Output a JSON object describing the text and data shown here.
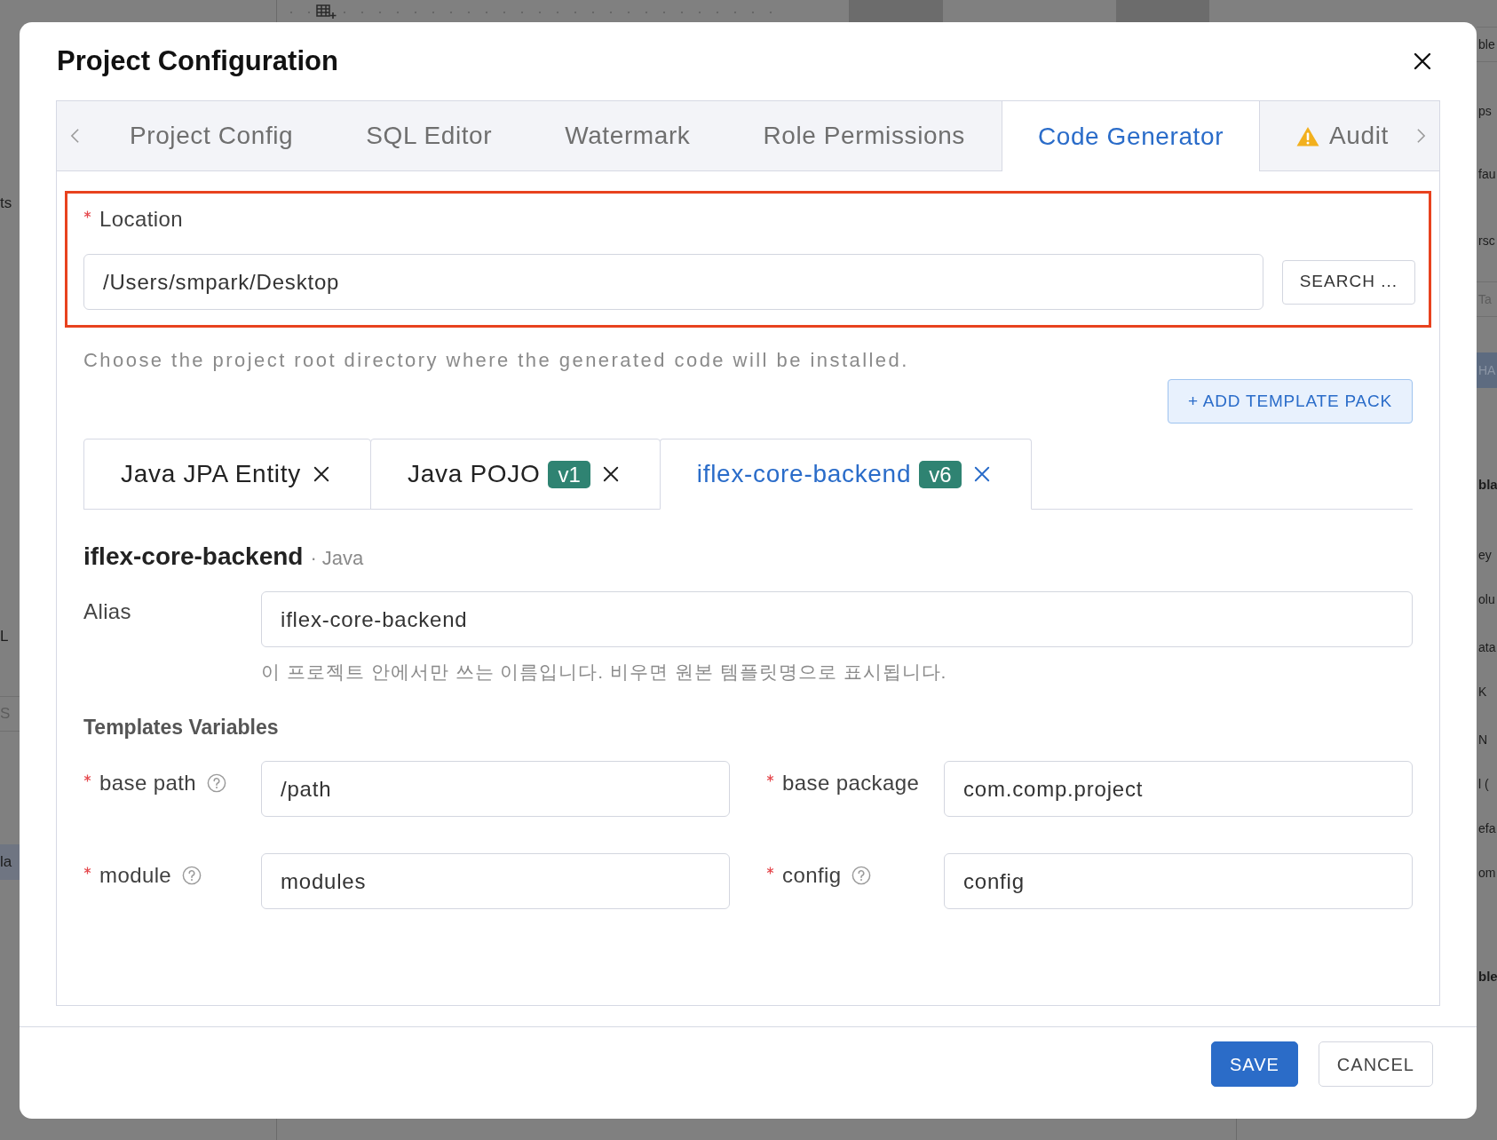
{
  "backdrop": {
    "left_fragments": [
      {
        "text": "ts",
        "kind": "row"
      },
      {
        "text": "L",
        "kind": "row"
      },
      {
        "text": "S",
        "kind": "placeholder"
      },
      {
        "text": "la",
        "kind": "selected"
      }
    ],
    "right_fragments": [
      {
        "text": "ble",
        "kind": "field"
      },
      {
        "text": "ps",
        "kind": "row"
      },
      {
        "text": "fau",
        "kind": "row"
      },
      {
        "text": "rsc",
        "kind": "row"
      },
      {
        "text": "Ta",
        "kind": "placeholder"
      },
      {
        "text": "HA",
        "kind": "button"
      },
      {
        "text": "bla",
        "kind": "heading"
      },
      {
        "text": "ey",
        "kind": "row"
      },
      {
        "text": "olu",
        "kind": "row"
      },
      {
        "text": "ata",
        "kind": "row"
      },
      {
        "text": "K",
        "kind": "row"
      },
      {
        "text": "N",
        "kind": "row"
      },
      {
        "text": "l (",
        "kind": "row"
      },
      {
        "text": "efa",
        "kind": "row"
      },
      {
        "text": "om",
        "kind": "row"
      },
      {
        "text": "ble",
        "kind": "heading"
      }
    ]
  },
  "dialog": {
    "title": "Project Configuration",
    "tabs": [
      {
        "label": "Project Config",
        "selected": false,
        "warning": false
      },
      {
        "label": "SQL Editor",
        "selected": false,
        "warning": false
      },
      {
        "label": "Watermark",
        "selected": false,
        "warning": false
      },
      {
        "label": "Role Permissions",
        "selected": false,
        "warning": false
      },
      {
        "label": "Code Generator",
        "selected": true,
        "warning": false
      },
      {
        "label": "Audit",
        "selected": false,
        "warning": true
      }
    ],
    "location": {
      "label": "Location",
      "required": true,
      "highlighted": true,
      "value": "/Users/smpark/Desktop",
      "button": "SEARCH ...",
      "help": "Choose the project root directory where the generated code will be installed."
    },
    "add_template_button": "+ ADD TEMPLATE PACK",
    "template_tabs": [
      {
        "label": "Java JPA Entity",
        "selected": false
      },
      {
        "label": "Java POJO",
        "badge": "v1",
        "selected": false
      },
      {
        "label": "iflex-core-backend",
        "badge": "v6",
        "selected": true
      }
    ],
    "template": {
      "name": "iflex-core-backend",
      "language": "· Java",
      "alias_label": "Alias",
      "alias_value": "iflex-core-backend",
      "alias_hint": "이 프로젝트 안에서만 쓰는 이름입니다. 비우면 원본 템플릿명으로 표시됩니다.",
      "variables_title": "Templates Variables",
      "variables": [
        {
          "label": "base path",
          "required": true,
          "help": true,
          "value": "/path"
        },
        {
          "label": "base package",
          "required": true,
          "help": false,
          "value": "com.comp.project"
        },
        {
          "label": "module",
          "required": true,
          "help": true,
          "value": "modules"
        },
        {
          "label": "config",
          "required": true,
          "help": true,
          "value": "config"
        }
      ]
    },
    "buttons": [
      {
        "label": "SAVE",
        "kind": "primary"
      },
      {
        "label": "CANCEL",
        "kind": "secondary"
      }
    ]
  }
}
